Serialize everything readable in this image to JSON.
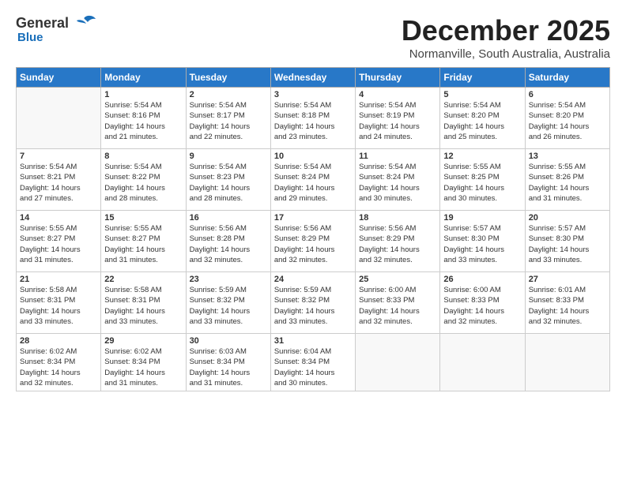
{
  "logo": {
    "general": "General",
    "blue": "Blue"
  },
  "title": "December 2025",
  "location": "Normanville, South Australia, Australia",
  "days_of_week": [
    "Sunday",
    "Monday",
    "Tuesday",
    "Wednesday",
    "Thursday",
    "Friday",
    "Saturday"
  ],
  "weeks": [
    [
      {
        "num": "",
        "lines": []
      },
      {
        "num": "1",
        "lines": [
          "Sunrise: 5:54 AM",
          "Sunset: 8:16 PM",
          "Daylight: 14 hours",
          "and 21 minutes."
        ]
      },
      {
        "num": "2",
        "lines": [
          "Sunrise: 5:54 AM",
          "Sunset: 8:17 PM",
          "Daylight: 14 hours",
          "and 22 minutes."
        ]
      },
      {
        "num": "3",
        "lines": [
          "Sunrise: 5:54 AM",
          "Sunset: 8:18 PM",
          "Daylight: 14 hours",
          "and 23 minutes."
        ]
      },
      {
        "num": "4",
        "lines": [
          "Sunrise: 5:54 AM",
          "Sunset: 8:19 PM",
          "Daylight: 14 hours",
          "and 24 minutes."
        ]
      },
      {
        "num": "5",
        "lines": [
          "Sunrise: 5:54 AM",
          "Sunset: 8:20 PM",
          "Daylight: 14 hours",
          "and 25 minutes."
        ]
      },
      {
        "num": "6",
        "lines": [
          "Sunrise: 5:54 AM",
          "Sunset: 8:20 PM",
          "Daylight: 14 hours",
          "and 26 minutes."
        ]
      }
    ],
    [
      {
        "num": "7",
        "lines": [
          "Sunrise: 5:54 AM",
          "Sunset: 8:21 PM",
          "Daylight: 14 hours",
          "and 27 minutes."
        ]
      },
      {
        "num": "8",
        "lines": [
          "Sunrise: 5:54 AM",
          "Sunset: 8:22 PM",
          "Daylight: 14 hours",
          "and 28 minutes."
        ]
      },
      {
        "num": "9",
        "lines": [
          "Sunrise: 5:54 AM",
          "Sunset: 8:23 PM",
          "Daylight: 14 hours",
          "and 28 minutes."
        ]
      },
      {
        "num": "10",
        "lines": [
          "Sunrise: 5:54 AM",
          "Sunset: 8:24 PM",
          "Daylight: 14 hours",
          "and 29 minutes."
        ]
      },
      {
        "num": "11",
        "lines": [
          "Sunrise: 5:54 AM",
          "Sunset: 8:24 PM",
          "Daylight: 14 hours",
          "and 30 minutes."
        ]
      },
      {
        "num": "12",
        "lines": [
          "Sunrise: 5:55 AM",
          "Sunset: 8:25 PM",
          "Daylight: 14 hours",
          "and 30 minutes."
        ]
      },
      {
        "num": "13",
        "lines": [
          "Sunrise: 5:55 AM",
          "Sunset: 8:26 PM",
          "Daylight: 14 hours",
          "and 31 minutes."
        ]
      }
    ],
    [
      {
        "num": "14",
        "lines": [
          "Sunrise: 5:55 AM",
          "Sunset: 8:27 PM",
          "Daylight: 14 hours",
          "and 31 minutes."
        ]
      },
      {
        "num": "15",
        "lines": [
          "Sunrise: 5:55 AM",
          "Sunset: 8:27 PM",
          "Daylight: 14 hours",
          "and 31 minutes."
        ]
      },
      {
        "num": "16",
        "lines": [
          "Sunrise: 5:56 AM",
          "Sunset: 8:28 PM",
          "Daylight: 14 hours",
          "and 32 minutes."
        ]
      },
      {
        "num": "17",
        "lines": [
          "Sunrise: 5:56 AM",
          "Sunset: 8:29 PM",
          "Daylight: 14 hours",
          "and 32 minutes."
        ]
      },
      {
        "num": "18",
        "lines": [
          "Sunrise: 5:56 AM",
          "Sunset: 8:29 PM",
          "Daylight: 14 hours",
          "and 32 minutes."
        ]
      },
      {
        "num": "19",
        "lines": [
          "Sunrise: 5:57 AM",
          "Sunset: 8:30 PM",
          "Daylight: 14 hours",
          "and 33 minutes."
        ]
      },
      {
        "num": "20",
        "lines": [
          "Sunrise: 5:57 AM",
          "Sunset: 8:30 PM",
          "Daylight: 14 hours",
          "and 33 minutes."
        ]
      }
    ],
    [
      {
        "num": "21",
        "lines": [
          "Sunrise: 5:58 AM",
          "Sunset: 8:31 PM",
          "Daylight: 14 hours",
          "and 33 minutes."
        ]
      },
      {
        "num": "22",
        "lines": [
          "Sunrise: 5:58 AM",
          "Sunset: 8:31 PM",
          "Daylight: 14 hours",
          "and 33 minutes."
        ]
      },
      {
        "num": "23",
        "lines": [
          "Sunrise: 5:59 AM",
          "Sunset: 8:32 PM",
          "Daylight: 14 hours",
          "and 33 minutes."
        ]
      },
      {
        "num": "24",
        "lines": [
          "Sunrise: 5:59 AM",
          "Sunset: 8:32 PM",
          "Daylight: 14 hours",
          "and 33 minutes."
        ]
      },
      {
        "num": "25",
        "lines": [
          "Sunrise: 6:00 AM",
          "Sunset: 8:33 PM",
          "Daylight: 14 hours",
          "and 32 minutes."
        ]
      },
      {
        "num": "26",
        "lines": [
          "Sunrise: 6:00 AM",
          "Sunset: 8:33 PM",
          "Daylight: 14 hours",
          "and 32 minutes."
        ]
      },
      {
        "num": "27",
        "lines": [
          "Sunrise: 6:01 AM",
          "Sunset: 8:33 PM",
          "Daylight: 14 hours",
          "and 32 minutes."
        ]
      }
    ],
    [
      {
        "num": "28",
        "lines": [
          "Sunrise: 6:02 AM",
          "Sunset: 8:34 PM",
          "Daylight: 14 hours",
          "and 32 minutes."
        ]
      },
      {
        "num": "29",
        "lines": [
          "Sunrise: 6:02 AM",
          "Sunset: 8:34 PM",
          "Daylight: 14 hours",
          "and 31 minutes."
        ]
      },
      {
        "num": "30",
        "lines": [
          "Sunrise: 6:03 AM",
          "Sunset: 8:34 PM",
          "Daylight: 14 hours",
          "and 31 minutes."
        ]
      },
      {
        "num": "31",
        "lines": [
          "Sunrise: 6:04 AM",
          "Sunset: 8:34 PM",
          "Daylight: 14 hours",
          "and 30 minutes."
        ]
      },
      {
        "num": "",
        "lines": []
      },
      {
        "num": "",
        "lines": []
      },
      {
        "num": "",
        "lines": []
      }
    ]
  ]
}
